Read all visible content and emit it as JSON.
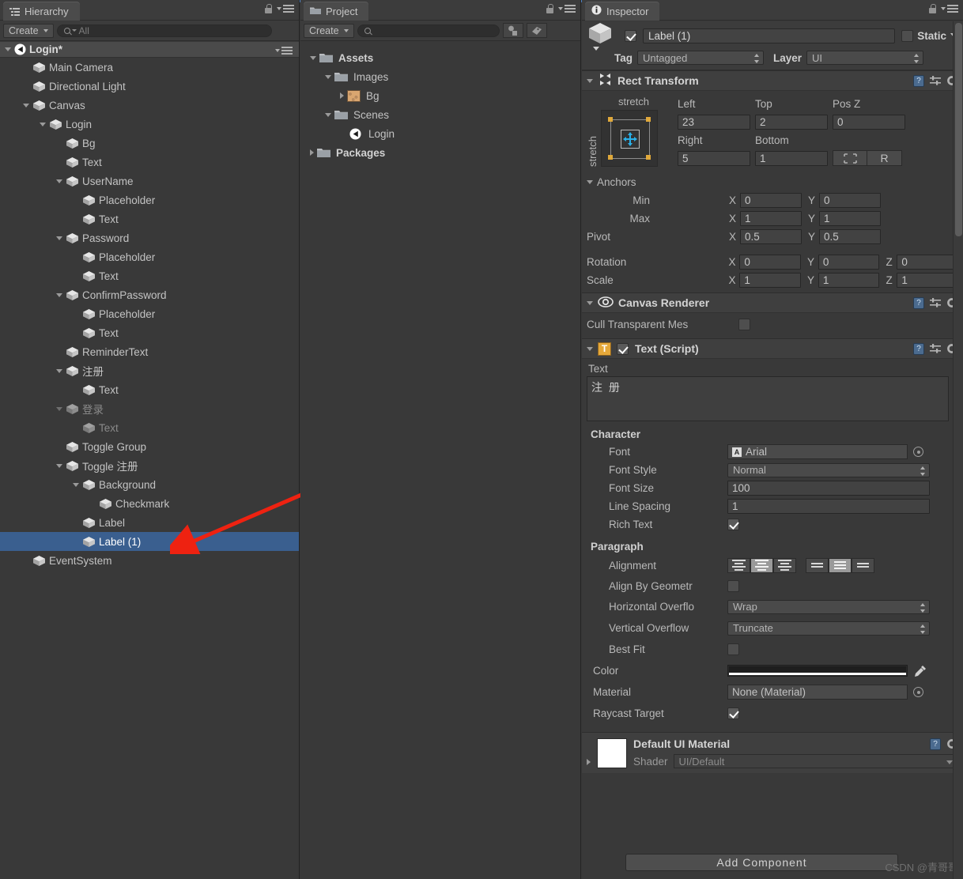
{
  "hierarchy": {
    "tab_label": "Hierarchy",
    "tab_icon": "hierarchy-icon",
    "create_label": "Create",
    "search_placeholder": "All",
    "scene_name": "Login*",
    "items": [
      {
        "label": "Main Camera",
        "depth": 1,
        "twirl": "none",
        "faded": false,
        "selected": false
      },
      {
        "label": "Directional Light",
        "depth": 1,
        "twirl": "none",
        "faded": false,
        "selected": false
      },
      {
        "label": "Canvas",
        "depth": 1,
        "twirl": "down",
        "faded": false,
        "selected": false
      },
      {
        "label": "Login",
        "depth": 2,
        "twirl": "down",
        "faded": false,
        "selected": false
      },
      {
        "label": "Bg",
        "depth": 3,
        "twirl": "none",
        "faded": false,
        "selected": false
      },
      {
        "label": "Text",
        "depth": 3,
        "twirl": "none",
        "faded": false,
        "selected": false
      },
      {
        "label": "UserName",
        "depth": 3,
        "twirl": "down",
        "faded": false,
        "selected": false
      },
      {
        "label": "Placeholder",
        "depth": 4,
        "twirl": "none",
        "faded": false,
        "selected": false
      },
      {
        "label": "Text",
        "depth": 4,
        "twirl": "none",
        "faded": false,
        "selected": false
      },
      {
        "label": "Password",
        "depth": 3,
        "twirl": "down",
        "faded": false,
        "selected": false
      },
      {
        "label": "Placeholder",
        "depth": 4,
        "twirl": "none",
        "faded": false,
        "selected": false
      },
      {
        "label": "Text",
        "depth": 4,
        "twirl": "none",
        "faded": false,
        "selected": false
      },
      {
        "label": "ConfirmPassword",
        "depth": 3,
        "twirl": "down",
        "faded": false,
        "selected": false
      },
      {
        "label": "Placeholder",
        "depth": 4,
        "twirl": "none",
        "faded": false,
        "selected": false
      },
      {
        "label": "Text",
        "depth": 4,
        "twirl": "none",
        "faded": false,
        "selected": false
      },
      {
        "label": "ReminderText",
        "depth": 3,
        "twirl": "none",
        "faded": false,
        "selected": false
      },
      {
        "label": "注册",
        "depth": 3,
        "twirl": "down",
        "faded": false,
        "selected": false
      },
      {
        "label": "Text",
        "depth": 4,
        "twirl": "none",
        "faded": false,
        "selected": false
      },
      {
        "label": "登录",
        "depth": 3,
        "twirl": "down",
        "faded": true,
        "selected": false
      },
      {
        "label": "Text",
        "depth": 4,
        "twirl": "none",
        "faded": true,
        "selected": false
      },
      {
        "label": "Toggle Group",
        "depth": 3,
        "twirl": "none",
        "faded": false,
        "selected": false
      },
      {
        "label": "Toggle 注册",
        "depth": 3,
        "twirl": "down",
        "faded": false,
        "selected": false
      },
      {
        "label": "Background",
        "depth": 4,
        "twirl": "down",
        "faded": false,
        "selected": false
      },
      {
        "label": "Checkmark",
        "depth": 5,
        "twirl": "none",
        "faded": false,
        "selected": false
      },
      {
        "label": "Label",
        "depth": 4,
        "twirl": "none",
        "faded": false,
        "selected": false
      },
      {
        "label": "Label (1)",
        "depth": 4,
        "twirl": "none",
        "faded": false,
        "selected": true
      },
      {
        "label": "EventSystem",
        "depth": 1,
        "twirl": "none",
        "faded": false,
        "selected": false
      }
    ]
  },
  "project": {
    "tab_label": "Project",
    "create_label": "Create",
    "search_placeholder": "",
    "items": [
      {
        "label": "Assets",
        "depth": 0,
        "twirl": "down",
        "icon": "folder-icon",
        "bold": true
      },
      {
        "label": "Images",
        "depth": 1,
        "twirl": "down",
        "icon": "folder-icon",
        "bold": false
      },
      {
        "label": "Bg",
        "depth": 2,
        "twirl": "right",
        "icon": "image-thumb",
        "bold": false
      },
      {
        "label": "Scenes",
        "depth": 1,
        "twirl": "down",
        "icon": "folder-icon",
        "bold": false
      },
      {
        "label": "Login",
        "depth": 2,
        "twirl": "none",
        "icon": "unity-scene-icon",
        "bold": false
      },
      {
        "label": "Packages",
        "depth": 0,
        "twirl": "right",
        "icon": "folder-icon",
        "bold": true
      }
    ]
  },
  "inspector": {
    "tab_label": "Inspector",
    "object": {
      "enabled": true,
      "name": "Label (1)",
      "static_label": "Static",
      "static_checked": false,
      "tag_label": "Tag",
      "tag_value": "Untagged",
      "layer_label": "Layer",
      "layer_value": "UI"
    },
    "rect_transform": {
      "title": "Rect Transform",
      "anchor_preset_top": "stretch",
      "anchor_preset_side": "stretch",
      "fields": {
        "left_label": "Left",
        "left": "23",
        "top_label": "Top",
        "top": "2",
        "posz_label": "Pos Z",
        "posz": "0",
        "right_label": "Right",
        "right": "5",
        "bottom_label": "Bottom",
        "bottom": "1"
      },
      "blueprint_label": "",
      "raw_label": "R",
      "anchors_label": "Anchors",
      "min_label": "Min",
      "min_x": "0",
      "min_y": "0",
      "max_label": "Max",
      "max_x": "1",
      "max_y": "1",
      "pivot_label": "Pivot",
      "pivot_x": "0.5",
      "pivot_y": "0.5",
      "rotation_label": "Rotation",
      "rot_x": "0",
      "rot_y": "0",
      "rot_z": "0",
      "scale_label": "Scale",
      "scale_x": "1",
      "scale_y": "1",
      "scale_z": "1"
    },
    "canvas_renderer": {
      "title": "Canvas Renderer",
      "cull_label": "Cull Transparent Mes",
      "cull_checked": false
    },
    "text_script": {
      "title": "Text (Script)",
      "enabled": true,
      "text_label": "Text",
      "text_value": "注 册",
      "character_label": "Character",
      "font_label": "Font",
      "font_value": "Arial",
      "font_style_label": "Font Style",
      "font_style_value": "Normal",
      "font_size_label": "Font Size",
      "font_size_value": "100",
      "line_spacing_label": "Line Spacing",
      "line_spacing_value": "1",
      "rich_text_label": "Rich Text",
      "rich_text_checked": true,
      "paragraph_label": "Paragraph",
      "alignment_label": "Alignment",
      "align_h_selected": 1,
      "align_v_selected": 1,
      "align_by_geometry_label": "Align By Geometr",
      "align_by_geometry_checked": false,
      "horizontal_overflow_label": "Horizontal Overflo",
      "horizontal_overflow_value": "Wrap",
      "vertical_overflow_label": "Vertical Overflow",
      "vertical_overflow_value": "Truncate",
      "best_fit_label": "Best Fit",
      "best_fit_checked": false,
      "color_label": "Color",
      "color_value": "#FFFFFF",
      "material_label": "Material",
      "material_value": "None (Material)",
      "raycast_target_label": "Raycast Target",
      "raycast_target_checked": true
    },
    "material": {
      "title": "Default UI Material",
      "shader_label": "Shader",
      "shader_value": "UI/Default"
    },
    "add_component_label": "Add Component",
    "watermark": "CSDN @青哥哥"
  },
  "colors": {
    "selection_blue": "#3a5f8f",
    "panel_bg": "#393939",
    "header_bg": "#3c3c3c",
    "annotation_arrow": "#ee2211",
    "accent_unity_blue": "#4f83c4"
  }
}
